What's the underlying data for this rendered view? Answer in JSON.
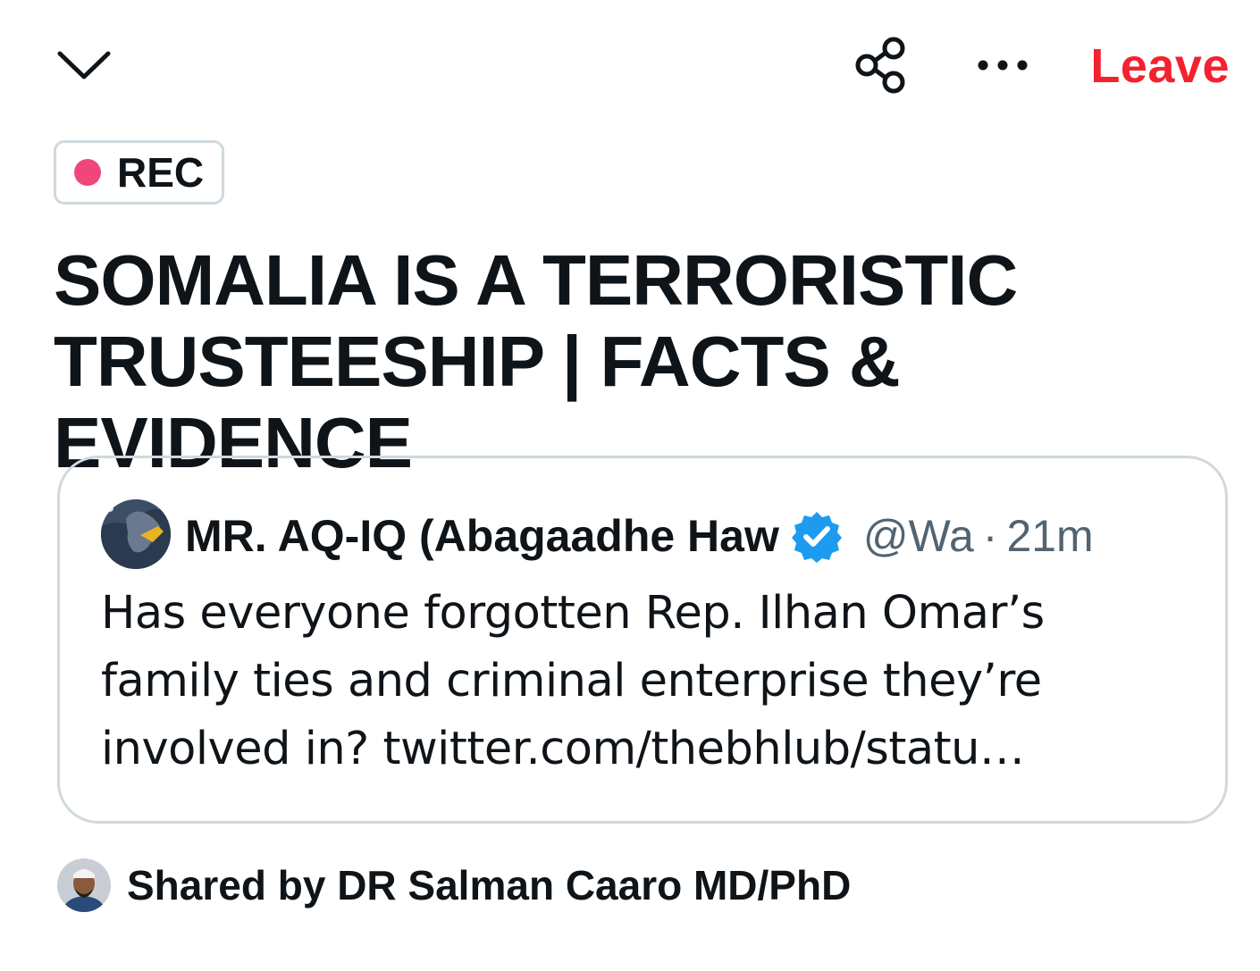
{
  "topbar": {
    "collapse_icon": "chevron-down-icon",
    "share_icon": "share-nodes-icon",
    "more_icon": "more-horizontal-icon",
    "leave_label": "Leave"
  },
  "recording": {
    "label": "REC"
  },
  "space": {
    "title": "SOMALIA IS A TERRORISTIC TRUSTEESHIP | FACTS & EVIDENCE"
  },
  "quoted_post": {
    "author_name": "MR. AQ-IQ (Abagaadhe Haw",
    "verified": true,
    "handle": "@Wa",
    "separator": "·",
    "time": "21m",
    "text": "Has everyone forgotten Rep. Ilhan Omar’s family ties and criminal enterprise they’re involved in? twitter.com/thebhlub/statu…"
  },
  "shared_by": {
    "label": "Shared by DR Salman Caaro MD/PhD"
  },
  "colors": {
    "leave": "#f4212e",
    "rec_dot": "#f0467a",
    "verified": "#1d9bf0",
    "border": "#cfd9de",
    "secondary_text": "#536471"
  }
}
